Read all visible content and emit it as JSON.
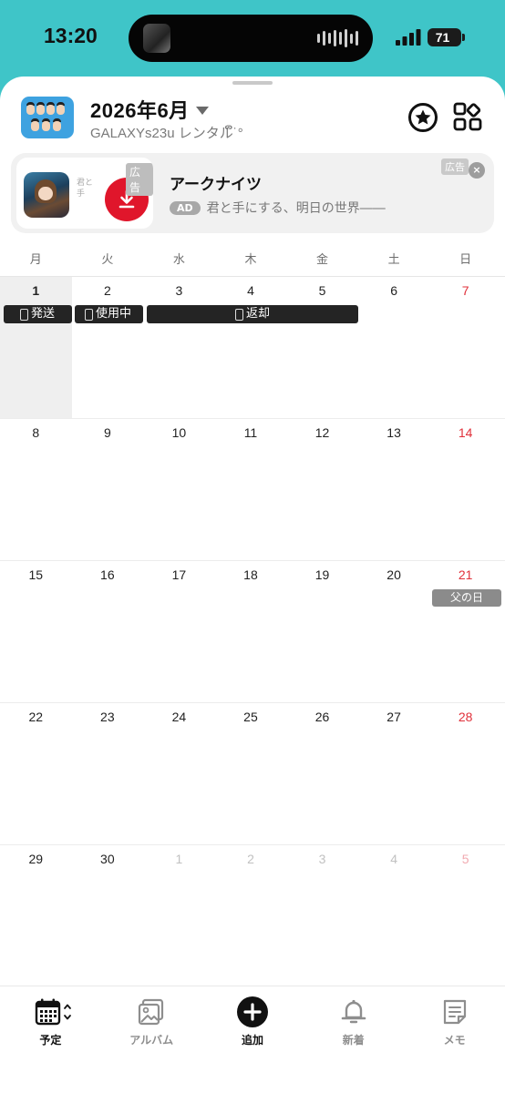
{
  "status_bar": {
    "time": "13:20",
    "battery": "71"
  },
  "header": {
    "title": "2026年6月",
    "subtitle": "GALAXYs23u レンタルຶ˙°"
  },
  "ad": {
    "title": "アークナイツ",
    "pill": "AD",
    "description": "君と手にする、明日の世界――",
    "badge_media": "広告",
    "badge_corner": "広告",
    "close": "×",
    "strip_text": "君と手"
  },
  "calendar": {
    "weekdays": [
      "月",
      "火",
      "水",
      "木",
      "金",
      "土",
      "日"
    ],
    "weeks": [
      {
        "days": [
          "1",
          "2",
          "3",
          "4",
          "5",
          "6",
          "7"
        ]
      },
      {
        "days": [
          "8",
          "9",
          "10",
          "11",
          "12",
          "13",
          "14"
        ]
      },
      {
        "days": [
          "15",
          "16",
          "17",
          "18",
          "19",
          "20",
          "21"
        ]
      },
      {
        "days": [
          "22",
          "23",
          "24",
          "25",
          "26",
          "27",
          "28"
        ]
      },
      {
        "days": [
          "29",
          "30",
          "1",
          "2",
          "3",
          "4",
          "5"
        ]
      }
    ],
    "events": [
      {
        "label": "発送",
        "start_day": "1",
        "end_day": "1"
      },
      {
        "label": "使用中",
        "start_day": "2",
        "end_day": "2"
      },
      {
        "label": "返却",
        "start_day": "3",
        "end_day": "5"
      }
    ],
    "holiday": {
      "label": "父の日",
      "day": "21"
    }
  },
  "tabbar": {
    "tabs": [
      {
        "label": "予定",
        "icon": "calendar-icon"
      },
      {
        "label": "アルバム",
        "icon": "album-icon"
      },
      {
        "label": "追加",
        "icon": "plus-circle-icon"
      },
      {
        "label": "新着",
        "icon": "bell-icon"
      },
      {
        "label": "メモ",
        "icon": "memo-icon"
      }
    ]
  },
  "colors": {
    "accent_top": "#3fc5c8",
    "sunday": "#e0303a",
    "event": "#242424",
    "ad_download": "#e0162b"
  }
}
